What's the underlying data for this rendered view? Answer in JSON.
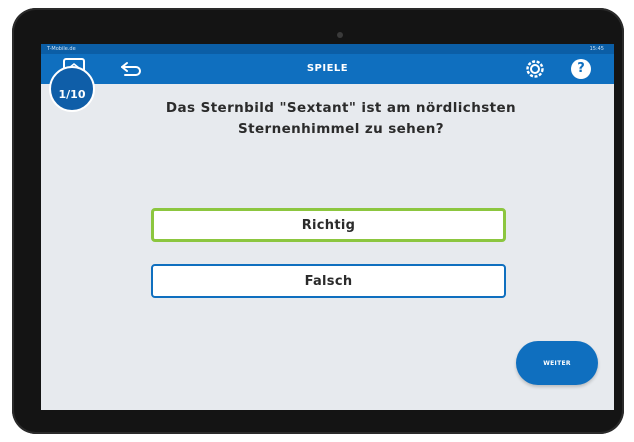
{
  "statusbar": {
    "left_text": "T-Mobile.de",
    "right_text": "15:45"
  },
  "appbar": {
    "title": "SPIELE"
  },
  "quiz": {
    "counter": "1/10",
    "question_line1": "Das Sternbild \"Sextant\" ist am nördlichsten",
    "question_line2": "Sternenhimmel zu sehen?",
    "answers": [
      {
        "label": "Richtig",
        "state": "selected"
      },
      {
        "label": "Falsch",
        "state": "default"
      }
    ],
    "next_label": "WEITER"
  },
  "colors": {
    "appbar": "#0f6fbf",
    "selected_border": "#8cc63f",
    "default_border": "#0f6fbf",
    "background": "#e7eaee"
  },
  "icons": [
    "home-icon",
    "back-arrow-icon",
    "gear-icon",
    "help-icon"
  ]
}
